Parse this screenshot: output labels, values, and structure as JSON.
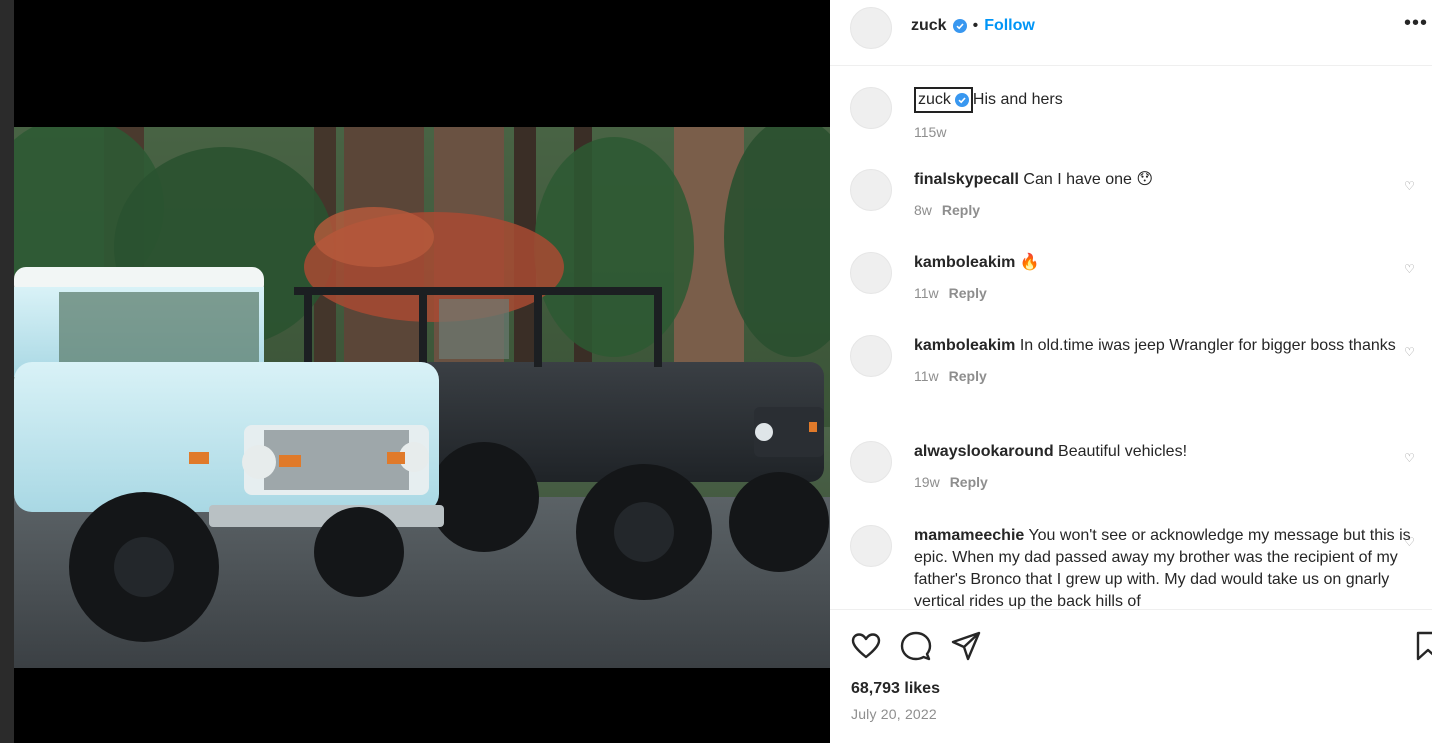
{
  "post": {
    "username": "zuck",
    "follow_label": "Follow",
    "separator": "•",
    "more_label": "•••"
  },
  "caption": {
    "username": "zuck",
    "text": "His and hers",
    "time": "115w"
  },
  "comments": [
    {
      "username": "finalskypecall",
      "text": "Can I have one 😯",
      "time": "8w",
      "reply": "Reply"
    },
    {
      "username": "kamboleakim",
      "text": "🔥",
      "time": "11w",
      "reply": "Reply"
    },
    {
      "username": "kamboleakim",
      "text": "In old.time iwas jeep Wrangler for bigger boss thanks",
      "time": "11w",
      "reply": "Reply"
    },
    {
      "username": "alwayslookaround",
      "text": "Beautiful vehicles!",
      "time": "19w",
      "reply": "Reply"
    },
    {
      "username": "mamameechie",
      "text": "You won't see or acknowledge my message but this is epic. When my dad passed away my brother was the recipient of my father's Bronco that I grew up with. My dad would take us on gnarly vertical rides up the back hills of",
      "time": "",
      "reply": ""
    }
  ],
  "footer": {
    "likes": "68,793 likes",
    "date": "July 20, 2022"
  },
  "icons": [
    "heart-icon",
    "comment-icon",
    "share-icon",
    "bookmark-icon",
    "verified-badge-icon",
    "more-icon"
  ],
  "colors": {
    "accent": "#0095f6",
    "verified": "#3897f0",
    "muted": "#8e8e8e",
    "text": "#262626"
  }
}
